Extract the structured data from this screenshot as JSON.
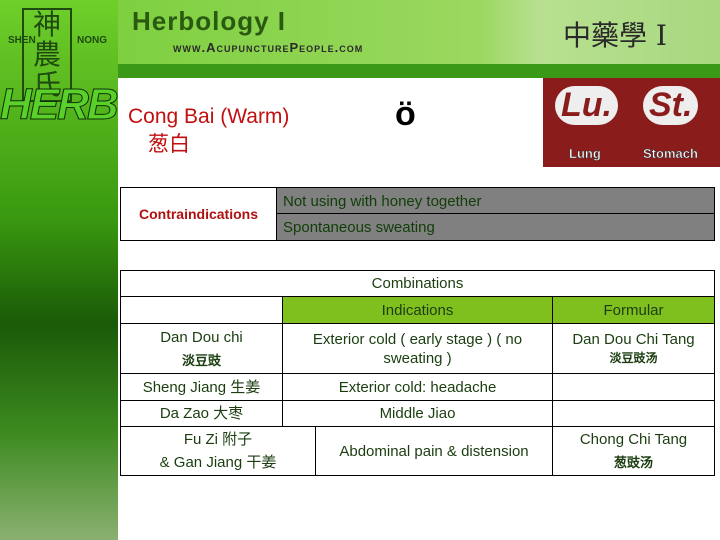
{
  "sidebar": {
    "logo_chars": "神農氏",
    "left_text": "SHEN",
    "right_text": "NONG",
    "herb": "HERB"
  },
  "header": {
    "title": "Herbology I",
    "url": "www.AcupuncturePeople.com",
    "chinese": "中藥學 I"
  },
  "meridians": {
    "lu": "Lu.",
    "st": "St.",
    "lung": "Lung",
    "stomach": "Stomach"
  },
  "herb": {
    "name": "Cong Bai  (Warm)",
    "chinese": "葱白",
    "icon": "surprised-face-icon",
    "face": "ö"
  },
  "contraindications": {
    "label": "Contraindications",
    "items": [
      "Not using with honey together",
      "Spontaneous sweating"
    ]
  },
  "combinations": {
    "title": "Combinations",
    "headers": [
      "",
      "Indications",
      "Formular"
    ],
    "rows": [
      {
        "herb": "Dan Dou chi",
        "herb_cn": "淡豆豉",
        "indication": "Exterior cold ( early stage ) ( no sweating )",
        "formula": "Dan Dou Chi Tang",
        "formula_cn": "淡豆豉汤"
      },
      {
        "herb": "Sheng Jiang   生姜",
        "indication": "Exterior cold: headache",
        "formula": ""
      },
      {
        "herb": "Da Zao 大枣",
        "indication": "Middle Jiao",
        "formula": ""
      },
      {
        "herb": "Fu Zi 附子",
        "herb2": "& Gan Jiang   干姜",
        "indication": "Abdominal pain & distension",
        "formula": "Chong Chi Tang",
        "formula_cn": "葱豉汤"
      }
    ]
  },
  "colors": {
    "header_green": "#7fbf1e",
    "title_red": "#c01010",
    "text_green": "#1b3d10",
    "gray": "#808080"
  }
}
